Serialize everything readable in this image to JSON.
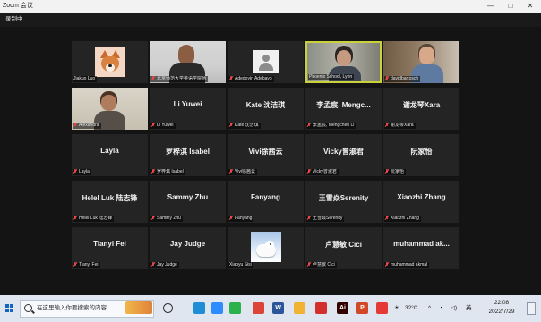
{
  "window": {
    "title": "Zoom 会议",
    "minimize_glyph": "—",
    "maximize_glyph": "□",
    "close_glyph": "✕"
  },
  "recording": {
    "label": "录制中"
  },
  "participants": [
    {
      "name": "Jiakuo Luo",
      "label": "Jiakuo Luo",
      "display": "",
      "kind": "avatar-fox",
      "muted": false
    },
    {
      "name": "北京师范大学英语学院杨",
      "label": "北京师范大学英语学院杨",
      "display": "",
      "kind": "video-man",
      "muted": true
    },
    {
      "name": "Adedoyin Adebayo",
      "label": "Adedoyin Adebayo",
      "display": "",
      "kind": "avatar-generic",
      "muted": true
    },
    {
      "name": "Phoenix School, Lynn",
      "label": "Phoenix School, Lynn",
      "display": "",
      "kind": "video-woman",
      "muted": false,
      "active": true
    },
    {
      "name": "David Bartosch",
      "label": "davidbartosch",
      "display": "",
      "kind": "video-david",
      "muted": true
    },
    {
      "name": "Alexandra",
      "label": "Alexandra",
      "display": "",
      "kind": "video-alex",
      "muted": true
    },
    {
      "name": "Li Yuwei",
      "label": "Li Yuwei",
      "display": "Li Yuwei",
      "kind": "name",
      "muted": true
    },
    {
      "name": "Kate 沈洁琪",
      "label": "Kate 沈洁琪",
      "display": "Kate 沈洁琪",
      "kind": "name",
      "muted": true
    },
    {
      "name": "李孟宸, Mengchen Li",
      "label": "李孟宸, Mengchen Li",
      "display": "李孟宸, Mengc...",
      "kind": "name",
      "muted": true
    },
    {
      "name": "谢龙琴Xara",
      "label": "谢龙琴Xara",
      "display": "谢龙琴Xara",
      "kind": "name",
      "muted": true
    },
    {
      "name": "Layla",
      "label": "Layla",
      "display": "Layla",
      "kind": "name",
      "muted": true
    },
    {
      "name": "罗梓淇 Isabel",
      "label": "罗梓淇 Isabel",
      "display": "罗梓淇 Isabel",
      "kind": "name",
      "muted": true
    },
    {
      "name": "Vivi徐茜云",
      "label": "Vivi徐茜云",
      "display": "Vivi徐茜云",
      "kind": "name",
      "muted": true
    },
    {
      "name": "Vicky曾淑君",
      "label": "Vicky曾淑君",
      "display": "Vicky曾淑君",
      "kind": "name",
      "muted": true
    },
    {
      "name": "阮家怡",
      "label": "阮家怡",
      "display": "阮家怡",
      "kind": "name",
      "muted": true
    },
    {
      "name": "Helel Luk 陆志锋",
      "label": "Helel Luk 陆志锋",
      "display": "Helel Luk 陆志锋",
      "kind": "name",
      "muted": true
    },
    {
      "name": "Sammy Zhu",
      "label": "Sammy Zhu",
      "display": "Sammy Zhu",
      "kind": "name",
      "muted": true
    },
    {
      "name": "Fanyang",
      "label": "Fanyang",
      "display": "Fanyang",
      "kind": "name",
      "muted": true
    },
    {
      "name": "王雪焱Serenity",
      "label": "王雪焱Serenity",
      "display": "王雪焱Serenity",
      "kind": "name",
      "muted": true
    },
    {
      "name": "Xiaozhi Zhang",
      "label": "Xiaozhi Zhang",
      "display": "Xiaozhi Zhang",
      "kind": "name",
      "muted": true
    },
    {
      "name": "Tianyi Fei",
      "label": "Tianyi Fei",
      "display": "Tianyi Fei",
      "kind": "name",
      "muted": true
    },
    {
      "name": "Jay Judge",
      "label": "Jay Judge",
      "display": "Jay Judge",
      "kind": "name",
      "muted": true
    },
    {
      "name": "Xiaoyu Sisi",
      "label": "Xiaoyu Sisi",
      "display": "",
      "kind": "avatar-seal",
      "muted": false
    },
    {
      "name": "卢慧敏 Cici",
      "label": "卢慧敏 Cici",
      "display": "卢慧敏 Cici",
      "kind": "name",
      "muted": true
    },
    {
      "name": "muhammad akmal",
      "label": "muhammad akmal",
      "display": "muhammad ak...",
      "kind": "name",
      "muted": true
    }
  ],
  "taskbar": {
    "search_placeholder": "在这里输入你要搜索的内容",
    "weather": "32°C",
    "ime": "英",
    "time": "22:08",
    "date": "2022/7/29",
    "icons": [
      {
        "name": "task-view-icon",
        "color": "#333333",
        "glyph": ""
      },
      {
        "name": "edge-icon",
        "color": "#1f8ed6",
        "glyph": ""
      },
      {
        "name": "zoom-icon",
        "color": "#2d8cff",
        "glyph": ""
      },
      {
        "name": "wechat-icon",
        "color": "#2bb24c",
        "glyph": ""
      },
      {
        "name": "chrome-icon",
        "color": "#db4437",
        "glyph": ""
      },
      {
        "name": "word-icon",
        "color": "#2b579a",
        "glyph": "W"
      },
      {
        "name": "file-explorer-icon",
        "color": "#f2b233",
        "glyph": ""
      },
      {
        "name": "acrobat-icon",
        "color": "#d32f2f",
        "glyph": ""
      },
      {
        "name": "illustrator-icon",
        "color": "#330000",
        "glyph": "Ai"
      },
      {
        "name": "powerpoint-icon",
        "color": "#d24726",
        "glyph": "P"
      },
      {
        "name": "red-app-icon",
        "color": "#e53935",
        "glyph": ""
      }
    ]
  }
}
